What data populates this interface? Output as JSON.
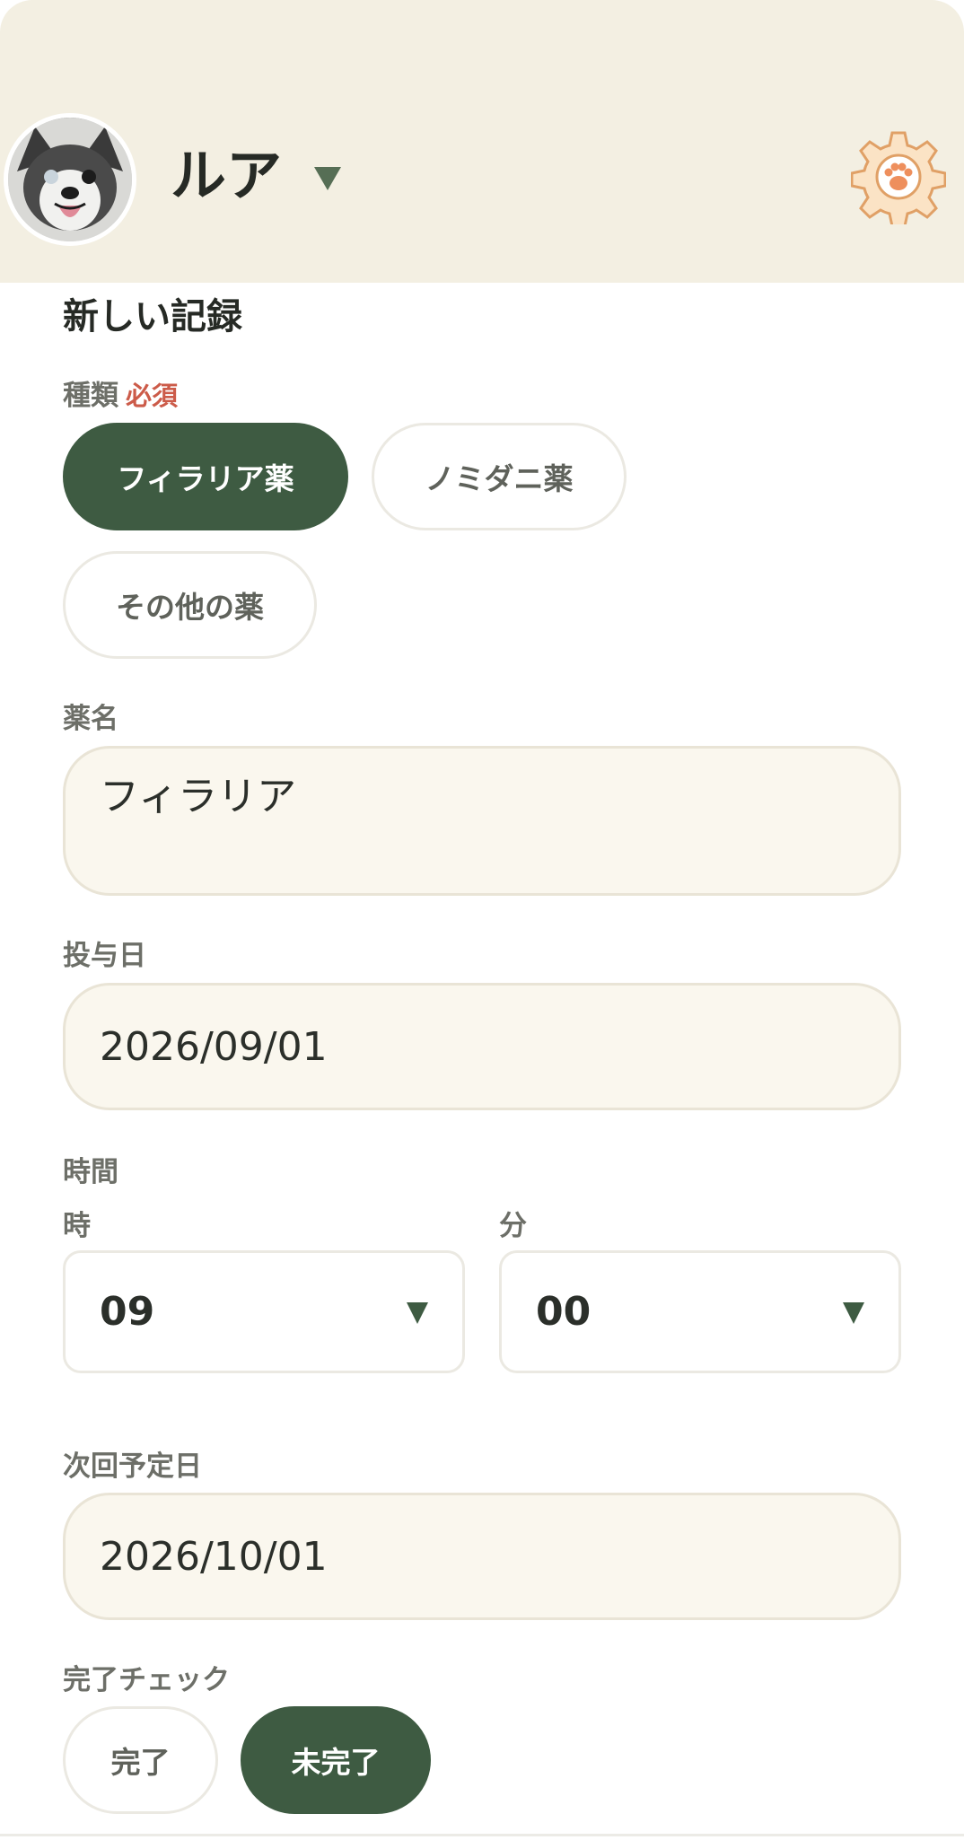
{
  "header": {
    "pet_name": "ルア",
    "avatar_icon": "dog-avatar",
    "settings_icon": "gear-paw-icon"
  },
  "form": {
    "title": "新しい記録",
    "type": {
      "label": "種類",
      "required_badge": "必須",
      "options": [
        "フィラリア薬",
        "ノミダニ薬",
        "その他の薬"
      ],
      "selected": "フィラリア薬"
    },
    "medicine_name": {
      "label": "薬名",
      "value": "フィラリア"
    },
    "dose_date": {
      "label": "投与日",
      "value": "2026/09/01"
    },
    "time": {
      "label": "時間",
      "hour_label": "時",
      "hour_value": "09",
      "minute_label": "分",
      "minute_value": "00"
    },
    "next_date": {
      "label": "次回予定日",
      "value": "2026/10/01"
    },
    "completion": {
      "label": "完了チェック",
      "options": [
        "完了",
        "未完了"
      ],
      "selected": "未完了"
    }
  },
  "colors": {
    "header_bg": "#f3efe2",
    "accent_green": "#3e5b42",
    "required_red": "#cc5b49",
    "field_bg": "#faf7ee"
  }
}
